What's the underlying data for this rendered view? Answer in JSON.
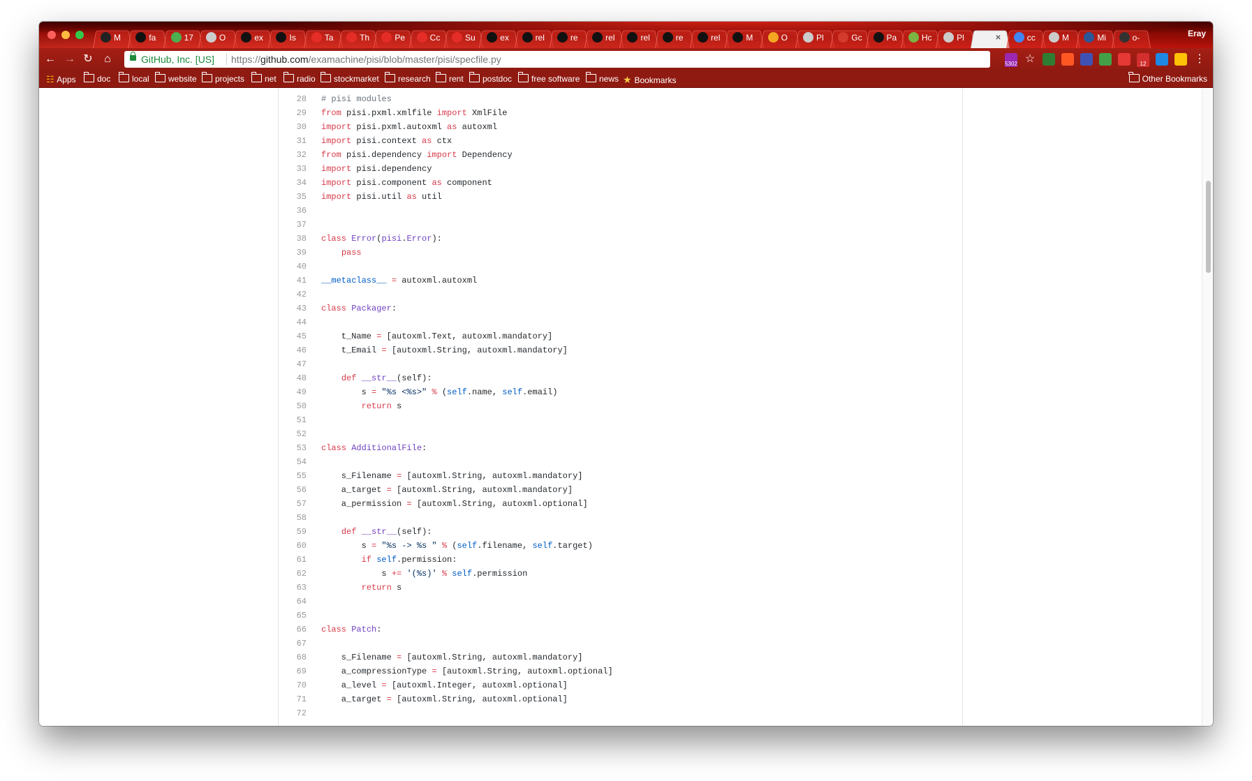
{
  "browser": {
    "profile_name": "Eray",
    "tabs": [
      {
        "label": "M",
        "favicon": "avatar-icon",
        "color": "#222222"
      },
      {
        "label": "fa",
        "favicon": "github-icon",
        "color": "#111111"
      },
      {
        "label": "17",
        "favicon": "whatsapp-icon",
        "color": "#4caf50"
      },
      {
        "label": "O",
        "favicon": "page-icon",
        "color": "#cccccc"
      },
      {
        "label": "ex",
        "favicon": "github-icon",
        "color": "#111111"
      },
      {
        "label": "Is",
        "favicon": "github-icon",
        "color": "#111111"
      },
      {
        "label": "Ta",
        "favicon": "youtube-icon",
        "color": "#e52d27"
      },
      {
        "label": "Th",
        "favicon": "youtube-icon",
        "color": "#e52d27"
      },
      {
        "label": "Pe",
        "favicon": "youtube-icon",
        "color": "#e52d27"
      },
      {
        "label": "Cc",
        "favicon": "youtube-icon",
        "color": "#e52d27"
      },
      {
        "label": "Su",
        "favicon": "youtube-icon",
        "color": "#e52d27"
      },
      {
        "label": "ex",
        "favicon": "github-icon",
        "color": "#111111"
      },
      {
        "label": "rel",
        "favicon": "github-icon",
        "color": "#111111"
      },
      {
        "label": "re",
        "favicon": "github-icon",
        "color": "#111111"
      },
      {
        "label": "rel",
        "favicon": "github-icon",
        "color": "#111111"
      },
      {
        "label": "rel",
        "favicon": "github-icon",
        "color": "#111111"
      },
      {
        "label": "re",
        "favicon": "github-icon",
        "color": "#111111"
      },
      {
        "label": "rel",
        "favicon": "github-icon",
        "color": "#111111"
      },
      {
        "label": "M",
        "favicon": "github-icon",
        "color": "#111111"
      },
      {
        "label": "O",
        "favicon": "bird-icon",
        "color": "#f5a623"
      },
      {
        "label": "Pl",
        "favicon": "page-icon",
        "color": "#cccccc"
      },
      {
        "label": "Gc",
        "favicon": "f-icon",
        "color": "#d33b2c"
      },
      {
        "label": "Pa",
        "favicon": "github-icon",
        "color": "#111111"
      },
      {
        "label": "Hc",
        "favicon": "hotjar-icon",
        "color": "#7cb342"
      },
      {
        "label": "Pl",
        "favicon": "page-icon",
        "color": "#cccccc"
      },
      {
        "label": "",
        "favicon": "close-icon",
        "color": "#222222",
        "active": true
      },
      {
        "label": "cc",
        "favicon": "google-icon",
        "color": "#4285f4"
      },
      {
        "label": "M",
        "favicon": "page-icon",
        "color": "#cccccc"
      },
      {
        "label": "Mi",
        "favicon": "w-icon",
        "color": "#2b579a"
      },
      {
        "label": "o-",
        "favicon": "h-icon",
        "color": "#333333"
      }
    ],
    "omnibox": {
      "site_identity": "GitHub, Inc. [US]",
      "url_scheme": "https://",
      "url_host": "github.com",
      "url_path": "/examachine/pisi/blob/master/pisi/specfile.py"
    },
    "bookmarks": [
      {
        "label": "Apps",
        "icon": "apps-grid-icon"
      },
      {
        "label": "doc",
        "icon": "folder-icon"
      },
      {
        "label": "local",
        "icon": "folder-icon"
      },
      {
        "label": "website",
        "icon": "folder-icon"
      },
      {
        "label": "projects",
        "icon": "folder-icon"
      },
      {
        "label": "net",
        "icon": "folder-icon"
      },
      {
        "label": "radio",
        "icon": "folder-icon"
      },
      {
        "label": "stockmarket",
        "icon": "folder-icon"
      },
      {
        "label": "research",
        "icon": "folder-icon"
      },
      {
        "label": "rent",
        "icon": "folder-icon"
      },
      {
        "label": "postdoc",
        "icon": "folder-icon"
      },
      {
        "label": "free software",
        "icon": "folder-icon"
      },
      {
        "label": "news",
        "icon": "folder-icon"
      },
      {
        "label": "Bookmarks",
        "icon": "star-icon"
      }
    ],
    "other_bookmarks": "Other Bookmarks",
    "extensions": [
      {
        "name": "ext-counter-icon",
        "badge": "5302",
        "color": "#9c27b0"
      },
      {
        "name": "star-icon",
        "badge": "",
        "color": "#ffffff"
      },
      {
        "name": "check-icon",
        "badge": "",
        "color": "#2e7d32"
      },
      {
        "name": "plus-icon",
        "badge": "",
        "color": "#ff5722"
      },
      {
        "name": "download-icon",
        "badge": "",
        "color": "#3f51b5"
      },
      {
        "name": "diamond-icon",
        "badge": "",
        "color": "#43a047"
      },
      {
        "name": "book-icon",
        "badge": "",
        "color": "#e53935"
      },
      {
        "name": "calendar-icon",
        "badge": "12",
        "color": "#d32f2f"
      },
      {
        "name": "window-icon",
        "badge": "",
        "color": "#1e88e5"
      },
      {
        "name": "lock-icon",
        "badge": "",
        "color": "#ffc107"
      },
      {
        "name": "menu-icon",
        "badge": "",
        "color": "#ffffff"
      }
    ]
  },
  "code_lines": [
    {
      "num": "28",
      "segs": [
        {
          "t": "# pisi modules",
          "c": "c"
        }
      ]
    },
    {
      "num": "29",
      "segs": [
        {
          "t": "from",
          "c": "k"
        },
        {
          "t": " pisi.pxml.xmlfile ",
          "c": ""
        },
        {
          "t": "import",
          "c": "k"
        },
        {
          "t": " XmlFile",
          "c": ""
        }
      ]
    },
    {
      "num": "30",
      "segs": [
        {
          "t": "import",
          "c": "k"
        },
        {
          "t": " pisi.pxml.autoxml ",
          "c": ""
        },
        {
          "t": "as",
          "c": "k"
        },
        {
          "t": " autoxml",
          "c": ""
        }
      ]
    },
    {
      "num": "31",
      "segs": [
        {
          "t": "import",
          "c": "k"
        },
        {
          "t": " pisi.context ",
          "c": ""
        },
        {
          "t": "as",
          "c": "k"
        },
        {
          "t": " ctx",
          "c": ""
        }
      ]
    },
    {
      "num": "32",
      "segs": [
        {
          "t": "from",
          "c": "k"
        },
        {
          "t": " pisi.dependency ",
          "c": ""
        },
        {
          "t": "import",
          "c": "k"
        },
        {
          "t": " Dependency",
          "c": ""
        }
      ]
    },
    {
      "num": "33",
      "segs": [
        {
          "t": "import",
          "c": "k"
        },
        {
          "t": " pisi.dependency",
          "c": ""
        }
      ]
    },
    {
      "num": "34",
      "segs": [
        {
          "t": "import",
          "c": "k"
        },
        {
          "t": " pisi.component ",
          "c": ""
        },
        {
          "t": "as",
          "c": "k"
        },
        {
          "t": " component",
          "c": ""
        }
      ]
    },
    {
      "num": "35",
      "segs": [
        {
          "t": "import",
          "c": "k"
        },
        {
          "t": " pisi.util ",
          "c": ""
        },
        {
          "t": "as",
          "c": "k"
        },
        {
          "t": " util",
          "c": ""
        }
      ]
    },
    {
      "num": "36",
      "segs": []
    },
    {
      "num": "37",
      "segs": []
    },
    {
      "num": "38",
      "segs": [
        {
          "t": "class",
          "c": "k"
        },
        {
          "t": " ",
          "c": ""
        },
        {
          "t": "Error",
          "c": "n"
        },
        {
          "t": "(",
          "c": ""
        },
        {
          "t": "pisi",
          "c": "n"
        },
        {
          "t": ".",
          "c": ""
        },
        {
          "t": "Error",
          "c": "n"
        },
        {
          "t": "):",
          "c": ""
        }
      ]
    },
    {
      "num": "39",
      "segs": [
        {
          "t": "    ",
          "c": ""
        },
        {
          "t": "pass",
          "c": "k"
        }
      ]
    },
    {
      "num": "40",
      "segs": []
    },
    {
      "num": "41",
      "segs": [
        {
          "t": "__metaclass__",
          "c": "b"
        },
        {
          "t": " ",
          "c": ""
        },
        {
          "t": "=",
          "c": "k"
        },
        {
          "t": " autoxml.autoxml",
          "c": ""
        }
      ]
    },
    {
      "num": "42",
      "segs": []
    },
    {
      "num": "43",
      "segs": [
        {
          "t": "class",
          "c": "k"
        },
        {
          "t": " ",
          "c": ""
        },
        {
          "t": "Packager",
          "c": "n"
        },
        {
          "t": ":",
          "c": ""
        }
      ]
    },
    {
      "num": "44",
      "segs": []
    },
    {
      "num": "45",
      "segs": [
        {
          "t": "    t_Name ",
          "c": ""
        },
        {
          "t": "=",
          "c": "k"
        },
        {
          "t": " [autoxml.Text, autoxml.mandatory]",
          "c": ""
        }
      ]
    },
    {
      "num": "46",
      "segs": [
        {
          "t": "    t_Email ",
          "c": ""
        },
        {
          "t": "=",
          "c": "k"
        },
        {
          "t": " [autoxml.String, autoxml.mandatory]",
          "c": ""
        }
      ]
    },
    {
      "num": "47",
      "segs": []
    },
    {
      "num": "48",
      "segs": [
        {
          "t": "    ",
          "c": ""
        },
        {
          "t": "def",
          "c": "k"
        },
        {
          "t": " ",
          "c": ""
        },
        {
          "t": "__str__",
          "c": "n"
        },
        {
          "t": "(",
          "c": ""
        },
        {
          "t": "self",
          "c": ""
        },
        {
          "t": "):",
          "c": ""
        }
      ]
    },
    {
      "num": "49",
      "segs": [
        {
          "t": "        s ",
          "c": ""
        },
        {
          "t": "=",
          "c": "k"
        },
        {
          "t": " ",
          "c": ""
        },
        {
          "t": "\"%s <%s>\"",
          "c": "s"
        },
        {
          "t": " ",
          "c": ""
        },
        {
          "t": "%",
          "c": "k"
        },
        {
          "t": " (",
          "c": ""
        },
        {
          "t": "self",
          "c": "b"
        },
        {
          "t": ".name, ",
          "c": ""
        },
        {
          "t": "self",
          "c": "b"
        },
        {
          "t": ".email)",
          "c": ""
        }
      ]
    },
    {
      "num": "50",
      "segs": [
        {
          "t": "        ",
          "c": ""
        },
        {
          "t": "return",
          "c": "k"
        },
        {
          "t": " s",
          "c": ""
        }
      ]
    },
    {
      "num": "51",
      "segs": []
    },
    {
      "num": "52",
      "segs": []
    },
    {
      "num": "53",
      "segs": [
        {
          "t": "class",
          "c": "k"
        },
        {
          "t": " ",
          "c": ""
        },
        {
          "t": "AdditionalFile",
          "c": "n"
        },
        {
          "t": ":",
          "c": ""
        }
      ]
    },
    {
      "num": "54",
      "segs": []
    },
    {
      "num": "55",
      "segs": [
        {
          "t": "    s_Filename ",
          "c": ""
        },
        {
          "t": "=",
          "c": "k"
        },
        {
          "t": " [autoxml.String, autoxml.mandatory]",
          "c": ""
        }
      ]
    },
    {
      "num": "56",
      "segs": [
        {
          "t": "    a_target ",
          "c": ""
        },
        {
          "t": "=",
          "c": "k"
        },
        {
          "t": " [autoxml.String, autoxml.mandatory]",
          "c": ""
        }
      ]
    },
    {
      "num": "57",
      "segs": [
        {
          "t": "    a_permission ",
          "c": ""
        },
        {
          "t": "=",
          "c": "k"
        },
        {
          "t": " [autoxml.String, autoxml.optional]",
          "c": ""
        }
      ]
    },
    {
      "num": "58",
      "segs": []
    },
    {
      "num": "59",
      "segs": [
        {
          "t": "    ",
          "c": ""
        },
        {
          "t": "def",
          "c": "k"
        },
        {
          "t": " ",
          "c": ""
        },
        {
          "t": "__str__",
          "c": "n"
        },
        {
          "t": "(",
          "c": ""
        },
        {
          "t": "self",
          "c": ""
        },
        {
          "t": "):",
          "c": ""
        }
      ]
    },
    {
      "num": "60",
      "segs": [
        {
          "t": "        s ",
          "c": ""
        },
        {
          "t": "=",
          "c": "k"
        },
        {
          "t": " ",
          "c": ""
        },
        {
          "t": "\"%s -> %s \"",
          "c": "s"
        },
        {
          "t": " ",
          "c": ""
        },
        {
          "t": "%",
          "c": "k"
        },
        {
          "t": " (",
          "c": ""
        },
        {
          "t": "self",
          "c": "b"
        },
        {
          "t": ".filename, ",
          "c": ""
        },
        {
          "t": "self",
          "c": "b"
        },
        {
          "t": ".target)",
          "c": ""
        }
      ]
    },
    {
      "num": "61",
      "segs": [
        {
          "t": "        ",
          "c": ""
        },
        {
          "t": "if",
          "c": "k"
        },
        {
          "t": " ",
          "c": ""
        },
        {
          "t": "self",
          "c": "b"
        },
        {
          "t": ".permission:",
          "c": ""
        }
      ]
    },
    {
      "num": "62",
      "segs": [
        {
          "t": "            s ",
          "c": ""
        },
        {
          "t": "+=",
          "c": "k"
        },
        {
          "t": " ",
          "c": ""
        },
        {
          "t": "'(%s)'",
          "c": "s"
        },
        {
          "t": " ",
          "c": ""
        },
        {
          "t": "%",
          "c": "k"
        },
        {
          "t": " ",
          "c": ""
        },
        {
          "t": "self",
          "c": "b"
        },
        {
          "t": ".permission",
          "c": ""
        }
      ]
    },
    {
      "num": "63",
      "segs": [
        {
          "t": "        ",
          "c": ""
        },
        {
          "t": "return",
          "c": "k"
        },
        {
          "t": " s",
          "c": ""
        }
      ]
    },
    {
      "num": "64",
      "segs": []
    },
    {
      "num": "65",
      "segs": []
    },
    {
      "num": "66",
      "segs": [
        {
          "t": "class",
          "c": "k"
        },
        {
          "t": " ",
          "c": ""
        },
        {
          "t": "Patch",
          "c": "n"
        },
        {
          "t": ":",
          "c": ""
        }
      ]
    },
    {
      "num": "67",
      "segs": []
    },
    {
      "num": "68",
      "segs": [
        {
          "t": "    s_Filename ",
          "c": ""
        },
        {
          "t": "=",
          "c": "k"
        },
        {
          "t": " [autoxml.String, autoxml.mandatory]",
          "c": ""
        }
      ]
    },
    {
      "num": "69",
      "segs": [
        {
          "t": "    a_compressionType ",
          "c": ""
        },
        {
          "t": "=",
          "c": "k"
        },
        {
          "t": " [autoxml.String, autoxml.optional]",
          "c": ""
        }
      ]
    },
    {
      "num": "70",
      "segs": [
        {
          "t": "    a_level ",
          "c": ""
        },
        {
          "t": "=",
          "c": "k"
        },
        {
          "t": " [autoxml.Integer, autoxml.optional]",
          "c": ""
        }
      ]
    },
    {
      "num": "71",
      "segs": [
        {
          "t": "    a_target ",
          "c": ""
        },
        {
          "t": "=",
          "c": "k"
        },
        {
          "t": " [autoxml.String, autoxml.optional]",
          "c": ""
        }
      ]
    },
    {
      "num": "72",
      "segs": []
    }
  ]
}
